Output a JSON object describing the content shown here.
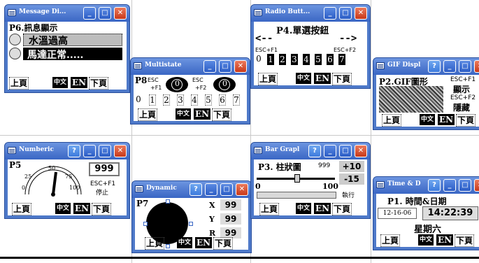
{
  "nav": {
    "prev": "上頁",
    "zh": "中文",
    "en": "EN",
    "next": "下頁"
  },
  "windows": {
    "message": {
      "title": "Message Di...",
      "heading": "P6.訊息顯示",
      "item1": "水溫過高",
      "item2": "馬達正常....."
    },
    "multistate": {
      "title": "Multistate",
      "heading": "P8",
      "esc1": "ESC",
      "f1": "+F1",
      "esc2": "ESC",
      "f2": "+F2",
      "btn1": "0",
      "btn2": "0",
      "digits": [
        "0",
        "1",
        "2",
        "3",
        "4",
        "5",
        "6",
        "7"
      ]
    },
    "radio": {
      "title": "Radio Butt...",
      "heading": "P4.單選按鈕",
      "left_arrow": "<--",
      "right_arrow": "-->",
      "esc_left": "ESC+F1",
      "esc_right": "ESC+F2",
      "digits": [
        "0",
        "1",
        "2",
        "3",
        "4",
        "5",
        "6",
        "7"
      ]
    },
    "gif": {
      "title": "GIF Displ",
      "heading": "P2.GIF圖形",
      "esc1": "ESC+F1",
      "show": "顯示",
      "esc2": "ESC+F2",
      "hide": "隱藏"
    },
    "numeric": {
      "title": "Numberic",
      "heading": "P5",
      "value": "999",
      "esc": "ESC+F1",
      "stop": "停止",
      "ticks": [
        "0",
        "25",
        "50",
        "75",
        "100"
      ]
    },
    "dynamic": {
      "title": "Dynamic",
      "heading": "P7",
      "x_label": "X",
      "x_val": "99",
      "y_label": "Y",
      "y_val": "99",
      "r_label": "R",
      "r_val": "99"
    },
    "bar": {
      "title": "Bar Grapl",
      "heading": "P3. 柱狀圖",
      "value": "999",
      "plus": "+10",
      "minus": "-15",
      "min": "0",
      "max": "100",
      "exec": "執行"
    },
    "time": {
      "title": "Time & D",
      "heading": "P1. 時間&日期",
      "date": "12-16-06",
      "time": "14:22:39",
      "weekday": "星期六"
    }
  }
}
